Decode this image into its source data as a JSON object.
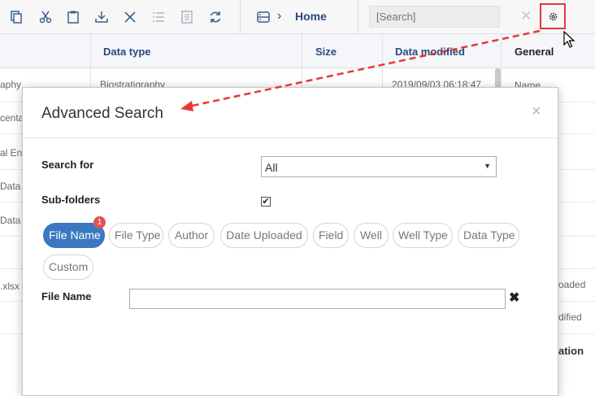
{
  "toolbar": {
    "icons": [
      "copy-icon",
      "cut-icon",
      "paste-icon",
      "download-icon",
      "delete-icon",
      "list-icon",
      "document-icon",
      "refresh-icon"
    ],
    "breadcrumb_icon": "storage-icon",
    "breadcrumb_home": "Home",
    "search_placeholder": "[Search]",
    "settings_icon": "gear-icon"
  },
  "table": {
    "headers": [
      "Data type",
      "Size",
      "Data modified",
      "General"
    ],
    "left_fragments": [
      "aphy",
      "centa",
      "al Env",
      "Data",
      "Data",
      ".xlsx"
    ],
    "data_type_cell": "Biostratigraphy",
    "date_cell": "2019/09/03 06:18:47",
    "general_fragments": [
      "Name",
      "oaded",
      "dified",
      "ation"
    ]
  },
  "modal": {
    "title": "Advanced Search",
    "close_symbol": "×",
    "search_for_label": "Search for",
    "search_for_value": "All",
    "subfolders_label": "Sub-folders",
    "subfolders_checked": true,
    "chips": [
      {
        "label": "File Name",
        "active": true
      },
      {
        "label": "File Type",
        "active": false
      },
      {
        "label": "Author",
        "active": false
      },
      {
        "label": "Date Uploaded",
        "active": false
      },
      {
        "label": "Field",
        "active": false
      },
      {
        "label": "Well",
        "active": false
      },
      {
        "label": "Well Type",
        "active": false
      },
      {
        "label": "Data Type",
        "active": false
      },
      {
        "label": "Custom",
        "active": false
      }
    ],
    "badge_count": "1",
    "file_name_label": "File Name",
    "file_name_value": "",
    "clear_symbol": "✖"
  },
  "colors": {
    "accent": "#3a78c2",
    "header_text": "#2b4a7a",
    "highlight": "#e53935",
    "badge": "#e55353"
  }
}
